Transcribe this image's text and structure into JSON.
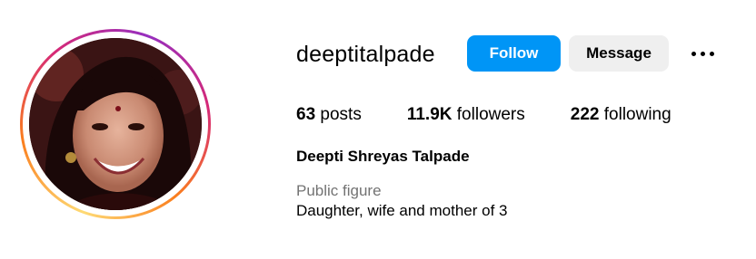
{
  "profile": {
    "username": "deeptitalpade",
    "full_name": "Deepti Shreyas Talpade",
    "category": "Public figure",
    "bio": "Daughter, wife and mother of 3",
    "follow_label": "Follow",
    "message_label": "Message",
    "more_icon": "more-options-icon",
    "avatar_icon": "profile-photo"
  },
  "stats": {
    "posts_count": "63",
    "posts_label": "posts",
    "followers_count": "11.9K",
    "followers_label": "followers",
    "following_count": "222",
    "following_label": "following"
  },
  "colors": {
    "follow_bg": "#0095f6",
    "message_bg": "#efefef",
    "category_text": "#737373"
  }
}
